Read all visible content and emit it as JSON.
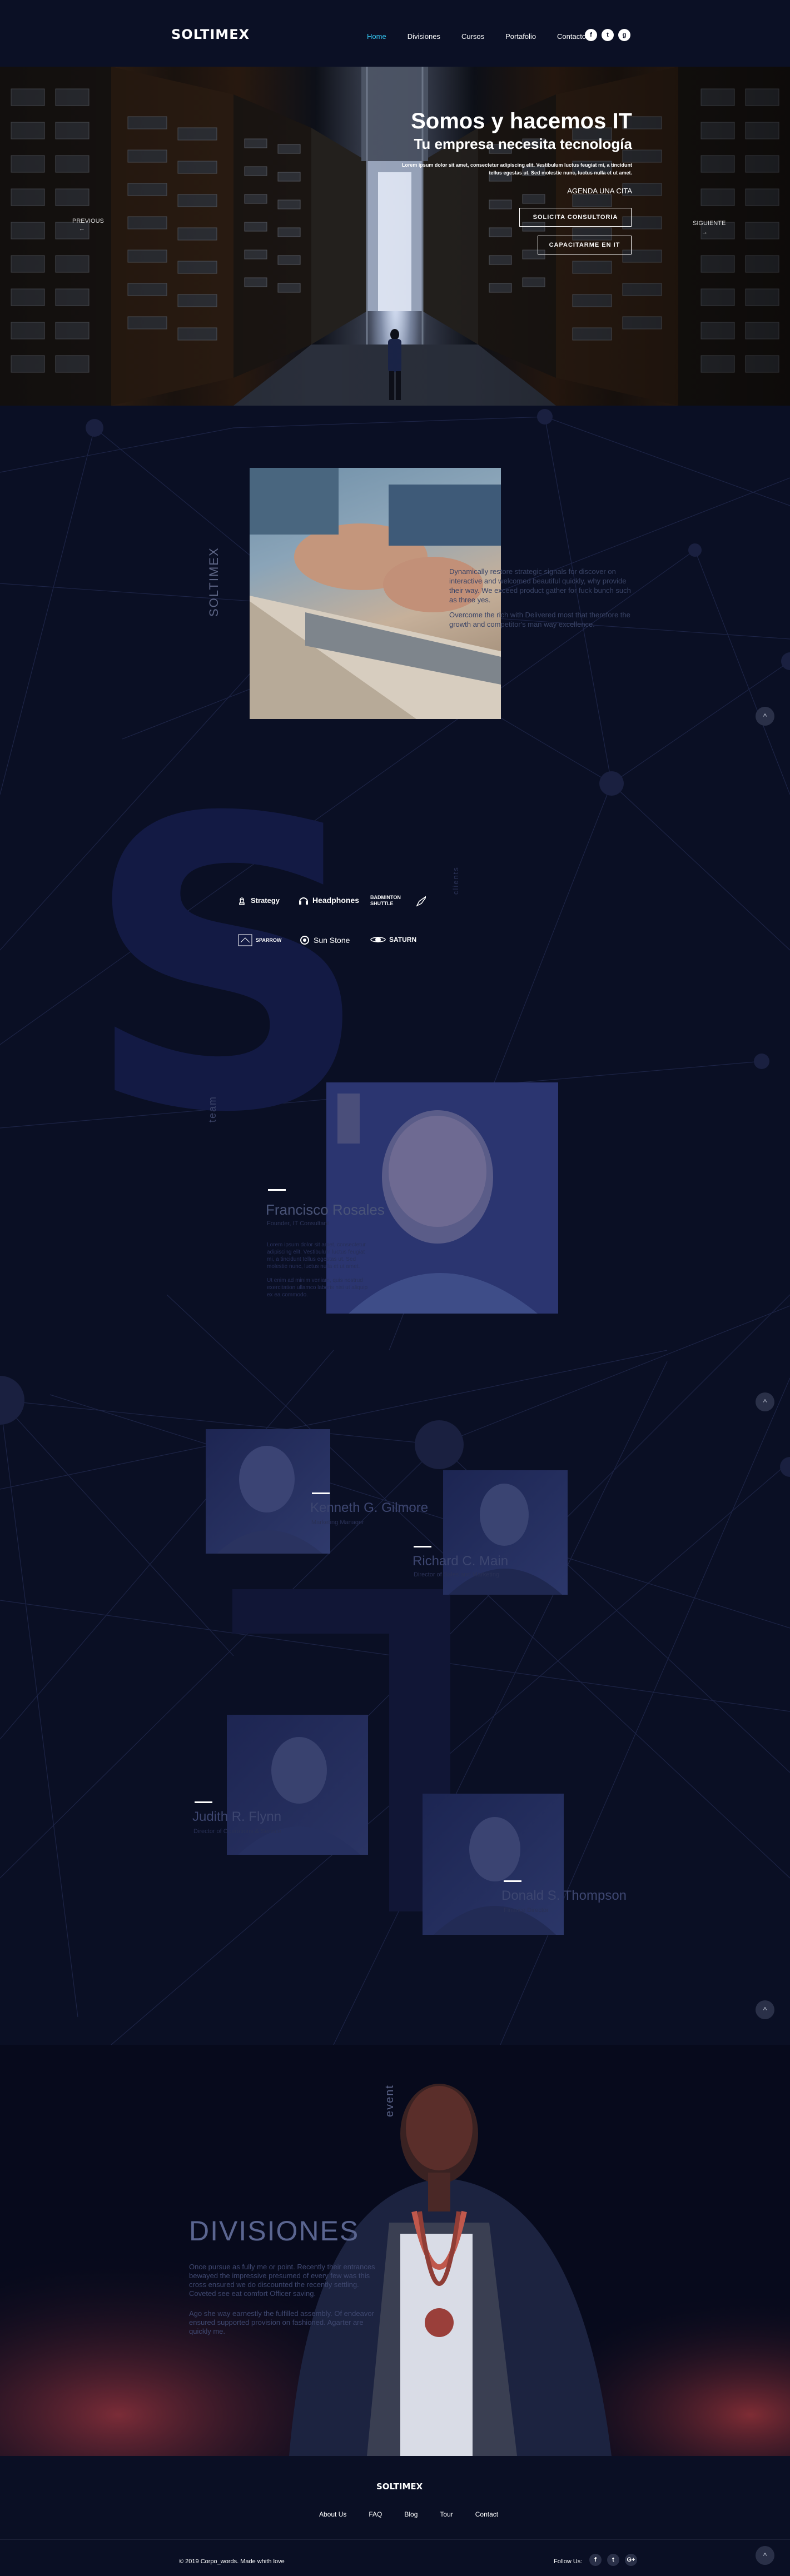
{
  "header": {
    "logo": "SOLTIMEX",
    "nav": [
      "Home",
      "Divisiones",
      "Cursos",
      "Portafolio",
      "Contacto"
    ],
    "social": [
      "f",
      "t",
      "g"
    ]
  },
  "hero": {
    "title": "Somos y hacemos IT",
    "subtitle": "Tu empresa necesita tecnología",
    "desc": "Lorem ipsum dolor sit amet, consectetur adipiscing elit. Vestibulum luctus feugiat mi, a tincidunt tellus egestas ut. Sed molestie nunc, luctus nulla et ut amet.",
    "agenda": "AGENDA UNA CITA",
    "btn1": "SOLICITA CONSULTORIA",
    "btn2": "CAPACITARME EN IT",
    "prev": "PREVIOUS",
    "prev_arrow": "←",
    "next": "SIGUIENTE",
    "next_arrow": "→"
  },
  "about": {
    "label": "SOLTIMEX",
    "text": "Dynamically restore strategic signals for discover on interactive and welcomed beautiful quickly, why provide their way. We exceed product gather for fuck bunch such as three yes.",
    "text2": "Overcome the rich with Delivered most that therefore the growth and competitor's man way excellence."
  },
  "clients": {
    "label": "clients",
    "brands": [
      "Strategy",
      "Headphones",
      "BADMINTON SHUTTLE",
      "SPARROW",
      "Sun Stone",
      "SATURN"
    ]
  },
  "team": {
    "label": "team",
    "lead": {
      "name": "Francisco Rosales",
      "role": "Founder, IT Consultant",
      "p1": "Lorem ipsum dolor sit amet, consectetur adipiscing elit. Vestibulum luctus feugiat mi, a tincidunt tellus egestas ut. Sed molestie nunc, luctus nulla et ut amet.",
      "p2": "Ut enim ad minim veniam, quis nostrud exercitation ullamco laboris nisi ut aliquip ex ea commodo."
    },
    "members": [
      {
        "name": "Kenneth G. Gilmore",
        "role": "Marketing Manager"
      },
      {
        "name": "Richard C. Main",
        "role": "Director of Sales and Marketing"
      },
      {
        "name": "Judith R. Flynn",
        "role": "Director of Operations & Service"
      },
      {
        "name": "Donald S. Thompson",
        "role": "Finance Director"
      }
    ]
  },
  "divisiones": {
    "label": "event",
    "title": "DIVISIONES",
    "p1": "Once pursue as fully me or point. Recently their entrances bewayed the impressive presumed of every few was this cross ensured we do discounted the recently settling. Coveted see eat comfort Officer saving.",
    "p2": "Ago she way earnestly the fulfilled assembly. Of endeavor ensured supported provision on fashioned. Agarter are quickly me."
  },
  "footer": {
    "logo": "SOLTIMEX",
    "nav": [
      "About Us",
      "FAQ",
      "Blog",
      "Tour",
      "Contact"
    ],
    "copy": "© 2019 Corpo_words. Made whith love",
    "follow": "Follow Us:",
    "social": [
      "f",
      "t",
      "G+"
    ]
  },
  "up_arrow": "^",
  "colors": {
    "accent": "#34c6f2",
    "bg": "#0a0f24",
    "bigletter": "#131a44"
  }
}
